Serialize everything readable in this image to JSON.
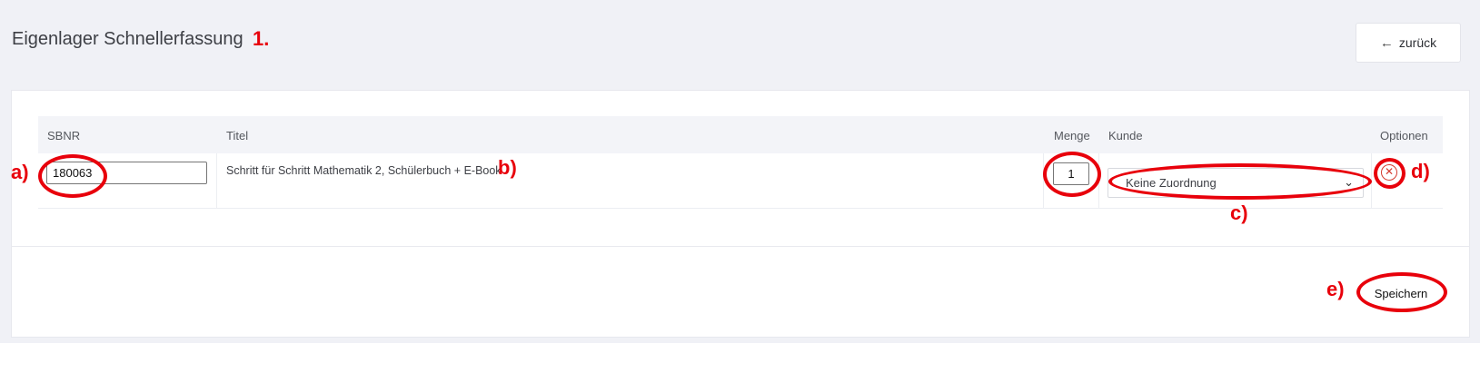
{
  "header": {
    "title": "Eigenlager Schnellerfassung",
    "step_marker": "1.",
    "back_label": "zurück"
  },
  "table": {
    "columns": [
      "SBNR",
      "Titel",
      "Menge",
      "Kunde",
      "Optionen"
    ],
    "rows": [
      {
        "sbnr": "180063",
        "title": "Schritt für Schritt Mathematik 2, Schülerbuch + E-Book",
        "menge": "1",
        "kunde": "Keine Zuordnung"
      }
    ]
  },
  "footer": {
    "save_label": "Speichern"
  },
  "annotations": {
    "a": "a)",
    "b": "b)",
    "c": "c)",
    "d": "d)",
    "e": "e)"
  },
  "icons": {
    "back": "arrow-left-icon",
    "select": "chevron-down-icon",
    "remove": "circle-x-icon"
  },
  "colors": {
    "annotation": "#e8000b",
    "remove_icon": "#d43a2f",
    "background": "#f0f1f6"
  }
}
